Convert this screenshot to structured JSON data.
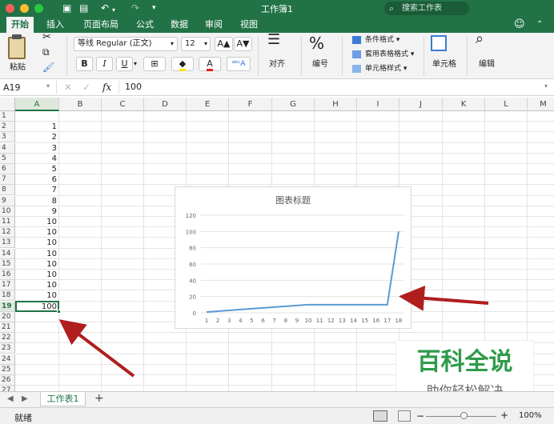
{
  "window": {
    "title": "工作簿1",
    "search_placeholder": "搜索工作表"
  },
  "ribbon_tabs": [
    "开始",
    "插入",
    "页面布局",
    "公式",
    "数据",
    "审阅",
    "视图"
  ],
  "ribbon": {
    "paste": "粘贴",
    "font_name": "等线 Regular (正文)",
    "font_size": "12",
    "grow_font": "A▲",
    "shrink_font": "A▼",
    "bold": "B",
    "italic": "I",
    "underline": "U",
    "align": "对齐",
    "number": "编号",
    "conditional_format": "条件格式 ▾",
    "table_format": "套用表格格式 ▾",
    "cell_styles": "单元格样式 ▾",
    "cells": "单元格",
    "edit": "编辑"
  },
  "formula_bar": {
    "name_box": "A19",
    "fx": "fx",
    "value": "100"
  },
  "columns": [
    "A",
    "B",
    "C",
    "D",
    "E",
    "F",
    "G",
    "H",
    "I",
    "J",
    "K",
    "L",
    "M"
  ],
  "rows": [
    "1",
    "2",
    "3",
    "4",
    "5",
    "6",
    "7",
    "8",
    "9",
    "10",
    "11",
    "12",
    "13",
    "14",
    "15",
    "16",
    "17",
    "18",
    "19",
    "20",
    "21",
    "22",
    "23",
    "24",
    "25",
    "26",
    "27"
  ],
  "column_a_values": [
    "",
    "1",
    "2",
    "3",
    "4",
    "5",
    "6",
    "7",
    "8",
    "9",
    "10",
    "10",
    "10",
    "10",
    "10",
    "10",
    "10",
    "10",
    "100",
    "",
    "",
    "",
    "",
    "",
    "",
    "",
    ""
  ],
  "chart_data": {
    "type": "line",
    "title": "图表标题",
    "x": [
      1,
      2,
      3,
      4,
      5,
      6,
      7,
      8,
      9,
      10,
      11,
      12,
      13,
      14,
      15,
      16,
      17,
      18
    ],
    "series": [
      {
        "values": [
          1,
          2,
          3,
          4,
          5,
          6,
          7,
          8,
          9,
          10,
          10,
          10,
          10,
          10,
          10,
          10,
          10,
          100
        ]
      }
    ],
    "ylim": [
      0,
      120
    ],
    "yticks": [
      "0",
      "20",
      "40",
      "60",
      "80",
      "100",
      "120"
    ],
    "xticks": [
      "1",
      "2",
      "3",
      "4",
      "5",
      "6",
      "7",
      "8",
      "9",
      "10",
      "11",
      "12",
      "13",
      "14",
      "15",
      "16",
      "17",
      "18"
    ],
    "grid": true,
    "line_color": "#5b9bd5"
  },
  "sheet_tabs": [
    "工作表1"
  ],
  "add_sheet": "+",
  "status": {
    "ready": "就绪",
    "zoom": "100%",
    "minus": "−",
    "plus": "+"
  },
  "watermark": {
    "title": "百科全说",
    "subtitle": "助你轻松解决"
  },
  "colors": {
    "excel_green": "#217346",
    "arrow_red": "#b01e1e",
    "selected_cell": "#217346"
  }
}
